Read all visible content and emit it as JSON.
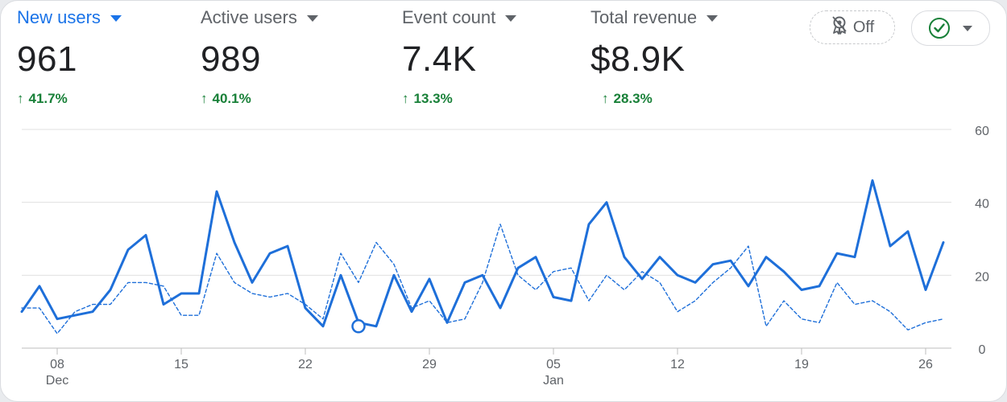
{
  "metrics": [
    {
      "label": "New users",
      "value": "961",
      "change": "41.7%",
      "selected": true
    },
    {
      "label": "Active users",
      "value": "989",
      "change": "40.1%",
      "selected": false
    },
    {
      "label": "Event count",
      "value": "7.4K",
      "change": "13.3%",
      "selected": false
    },
    {
      "label": "Total revenue",
      "value": "$8.9K",
      "change": "28.3%",
      "selected": false
    }
  ],
  "controls": {
    "comparison_toggle_label": "Off",
    "comparison_toggle_icon": "ribbon-badge-icon",
    "status_icon": "check-circle-icon"
  },
  "colors": {
    "accent": "#1a73e8",
    "series": "#1e6fd9",
    "positive": "#188038",
    "gridline": "#e0e0e0"
  },
  "chart_data": {
    "type": "line",
    "ylim": [
      0,
      60
    ],
    "yticks": [
      "0",
      "20",
      "40",
      "60"
    ],
    "xtick_labels": [
      {
        "day": "08",
        "month": "Dec"
      },
      {
        "day": "15",
        "month": ""
      },
      {
        "day": "22",
        "month": ""
      },
      {
        "day": "29",
        "month": ""
      },
      {
        "day": "05",
        "month": "Jan"
      },
      {
        "day": "12",
        "month": ""
      },
      {
        "day": "19",
        "month": ""
      },
      {
        "day": "26",
        "month": ""
      }
    ],
    "x_dates": [
      "Dec 06",
      "Dec 07",
      "Dec 08",
      "Dec 09",
      "Dec 10",
      "Dec 11",
      "Dec 12",
      "Dec 13",
      "Dec 14",
      "Dec 15",
      "Dec 16",
      "Dec 17",
      "Dec 18",
      "Dec 19",
      "Dec 20",
      "Dec 21",
      "Dec 22",
      "Dec 23",
      "Dec 24",
      "Dec 25",
      "Dec 26",
      "Dec 27",
      "Dec 28",
      "Dec 29",
      "Dec 30",
      "Dec 31",
      "Jan 01",
      "Jan 02",
      "Jan 03",
      "Jan 04",
      "Jan 05",
      "Jan 06",
      "Jan 07",
      "Jan 08",
      "Jan 09",
      "Jan 10",
      "Jan 11",
      "Jan 12",
      "Jan 13",
      "Jan 14",
      "Jan 15",
      "Jan 16",
      "Jan 17",
      "Jan 18",
      "Jan 19",
      "Jan 20",
      "Jan 21",
      "Jan 22",
      "Jan 23",
      "Jan 24",
      "Jan 25",
      "Jan 26"
    ],
    "series": [
      {
        "style": "solid",
        "values": [
          10,
          17,
          8,
          9,
          10,
          16,
          27,
          31,
          12,
          15,
          15,
          43,
          29,
          18,
          26,
          28,
          11,
          6,
          20,
          7,
          6,
          20,
          10,
          19,
          7,
          18,
          20,
          11,
          22,
          25,
          14,
          13,
          34,
          40,
          25,
          19,
          25,
          20,
          18,
          23,
          24,
          17,
          25,
          21,
          16,
          17,
          26,
          25,
          46,
          28,
          32,
          16,
          29
        ]
      },
      {
        "style": "dashed",
        "values": [
          11,
          11,
          4,
          10,
          12,
          12,
          18,
          18,
          17,
          9,
          9,
          26,
          18,
          15,
          14,
          15,
          12,
          8,
          26,
          18,
          29,
          23,
          11,
          13,
          7,
          8,
          18,
          34,
          20,
          16,
          21,
          22,
          13,
          20,
          16,
          21,
          18,
          10,
          13,
          18,
          22,
          28,
          6,
          13,
          8,
          7,
          18,
          12,
          13,
          10,
          5,
          7,
          8
        ]
      }
    ],
    "highlight_point": {
      "date": "Dec 25",
      "value": 6
    }
  }
}
